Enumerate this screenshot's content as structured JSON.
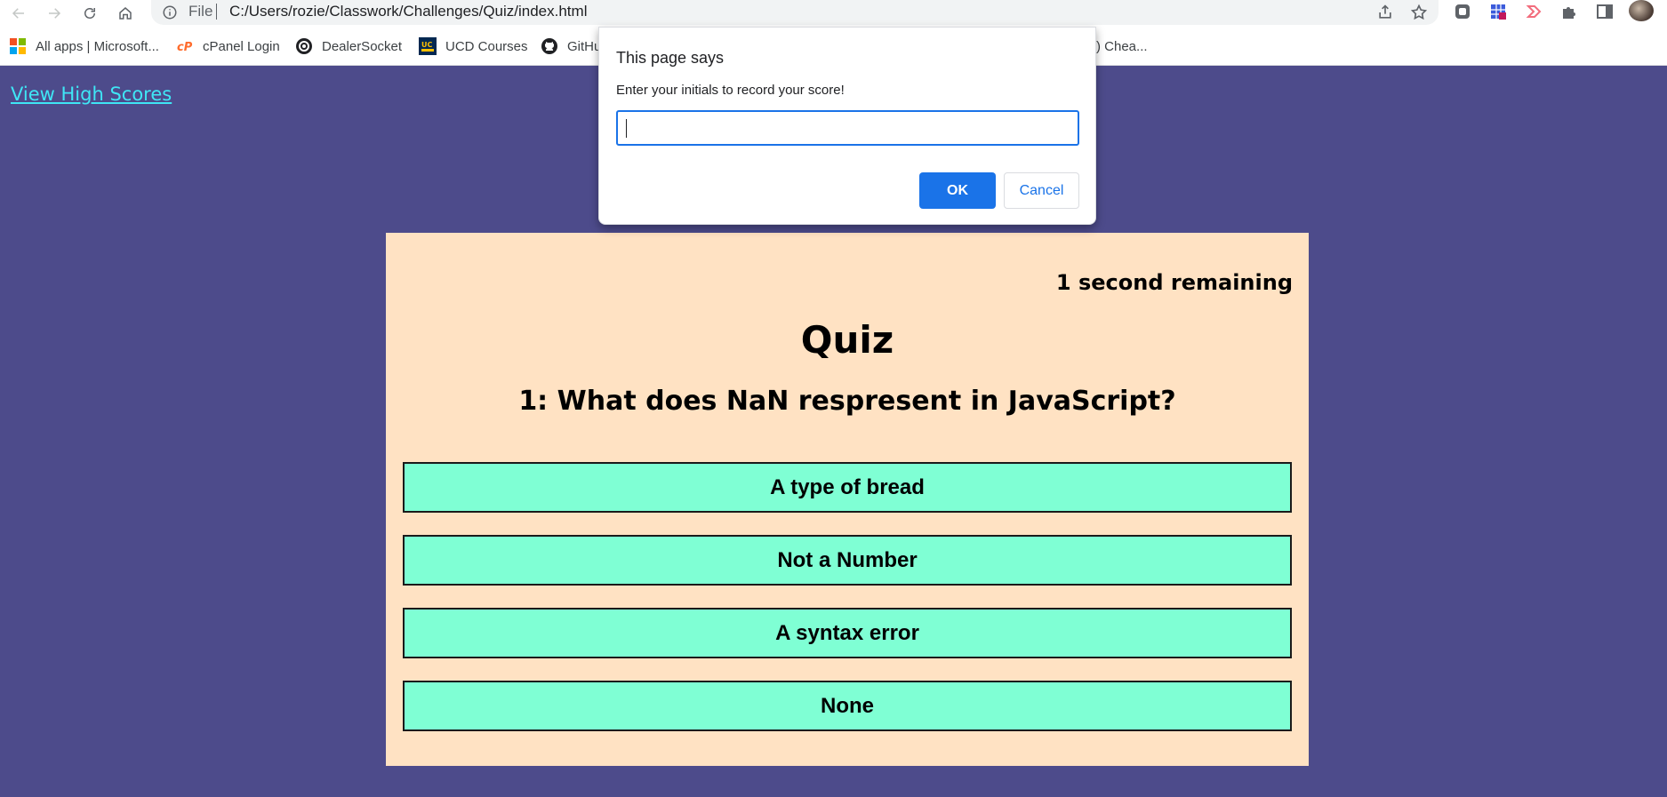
{
  "browser": {
    "omnibox": {
      "scheme_label": "File",
      "url": "C:/Users/rozie/Classwork/Challenges/Quiz/index.html"
    },
    "bookmarks": [
      {
        "label": "All apps | Microsoft...",
        "icon": "microsoft-icon"
      },
      {
        "label": "cPanel Login",
        "icon": "cpanel-icon"
      },
      {
        "label": "DealerSocket",
        "icon": "dealersocket-icon"
      },
      {
        "label": "UCD Courses",
        "icon": "ucd-icon"
      },
      {
        "label": "GitHu",
        "icon": "github-icon"
      },
      {
        "label": ") Chea...",
        "icon": ""
      }
    ],
    "colors": {
      "accent": "#1a73e8",
      "toolbar": "#ffffff",
      "omnibox": "#f1f3f4"
    }
  },
  "page": {
    "high_scores_link": "View High Scores",
    "timer": "1 second remaining",
    "title": "Quiz",
    "question": "1: What does NaN respresent in JavaScript?",
    "answers": [
      "A type of bread",
      "Not a Number",
      "A syntax error",
      "None"
    ],
    "colors": {
      "background": "#4d4b8b",
      "card": "#ffe2c3",
      "answer": "#7fffd4",
      "link": "#3fe6f5"
    }
  },
  "dialog": {
    "title": "This page says",
    "message": "Enter your initials to record your score!",
    "input_value": "",
    "ok_label": "OK",
    "cancel_label": "Cancel"
  }
}
